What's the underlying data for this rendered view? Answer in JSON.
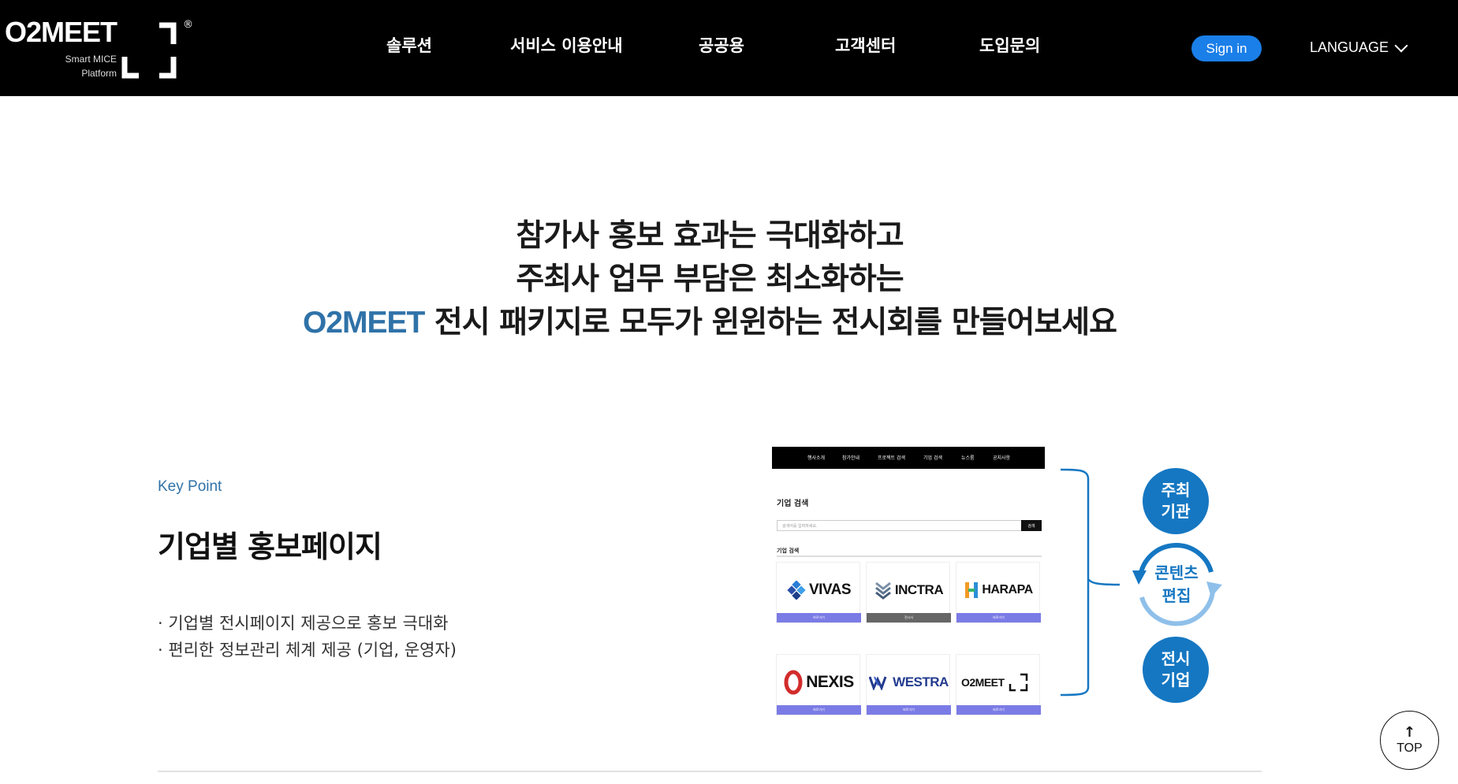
{
  "header": {
    "logo": {
      "wordmark": "O2MEET",
      "tagline_line1": "Smart MICE",
      "tagline_line2": "Platform",
      "reg": "®"
    },
    "nav": [
      "솔루션",
      "서비스 이용안내",
      "공공용",
      "고객센터",
      "도입문의"
    ],
    "signin_label": "Sign in",
    "language_label": "LANGUAGE"
  },
  "hero": {
    "line1": "참가사 홍보 효과는 극대화하고",
    "line2": "주최사 업무 부담은 최소화하는",
    "line3_brand": "O2MEET",
    "line3_rest": " 전시 패키지로 모두가 윈윈하는 전시회를 만들어보세요",
    "brand_color": "#2f72a8"
  },
  "keypoint": {
    "label": "Key Point",
    "title": "기업별 홍보페이지",
    "bullets": [
      "· 기업별 전시페이지 제공으로 홍보 극대화",
      "· 편리한 정보관리 체계 제공 (기업, 운영자)"
    ]
  },
  "mockup": {
    "nav": [
      "행사소개",
      "참가안내",
      "프로젝트 검색",
      "기업 검색",
      "뉴스룸",
      "공지사항"
    ],
    "page_title": "기업 검색",
    "search_placeholder": "검색어를 입력하세요.",
    "search_button": "검색",
    "list_title": "기업 검색",
    "cards": [
      {
        "name": "VIVAS",
        "icon": "diamond-cluster-icon",
        "button": "바로가기",
        "button_color": "#7b7be6"
      },
      {
        "name": "INCTRA",
        "icon": "chevron-stack-icon",
        "button": "전시사",
        "button_color": "#666666"
      },
      {
        "name": "HARAPA",
        "icon": "h-mark-icon",
        "button": "바로가기",
        "button_color": "#7b7be6"
      },
      {
        "name": "NEXIS",
        "icon": "ring-icon",
        "button": "바로가기",
        "button_color": "#7b7be6"
      },
      {
        "name": "WESTRA",
        "icon": "w-mark-icon",
        "button": "바로가기",
        "button_color": "#7b7be6"
      },
      {
        "name": "O2MEET",
        "icon": "o2meet-logo-icon",
        "button": "바로가기",
        "button_color": "#7b7be6"
      }
    ]
  },
  "diagram": {
    "host": "주최\n기관",
    "cycle": "콘텐츠\n편집",
    "exhibitor": "전시\n기업",
    "accent": "#1577c2",
    "cycle_light": "#8fc0ea"
  },
  "top_button": {
    "label": "TOP"
  }
}
